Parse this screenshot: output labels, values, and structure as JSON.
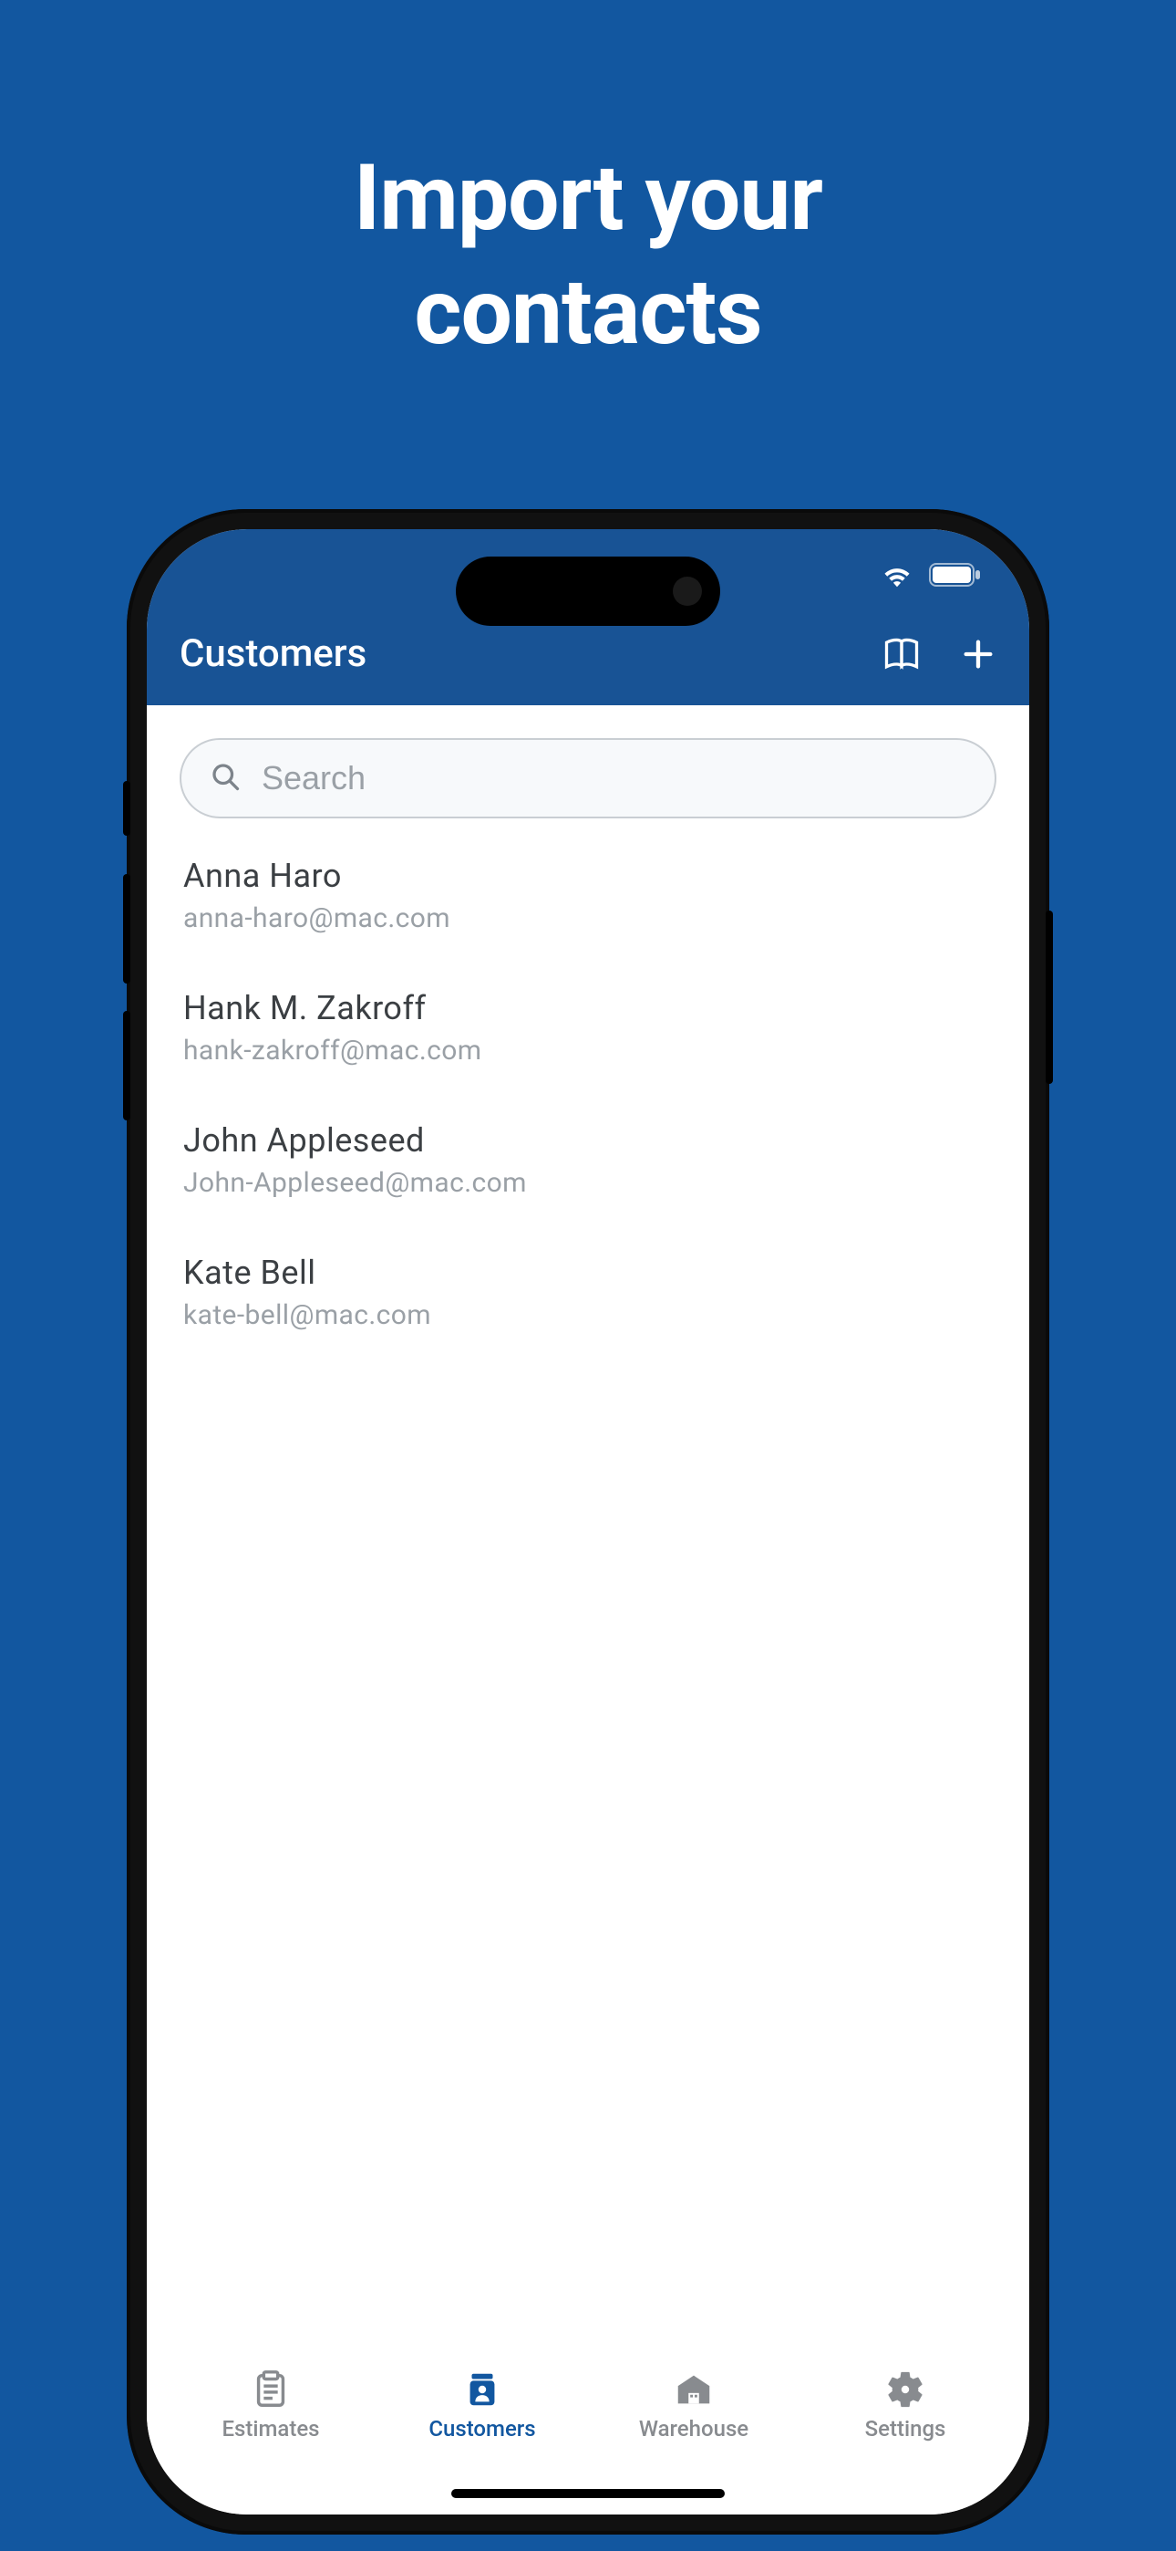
{
  "promo": {
    "title_line1": "Import your",
    "title_line2": "contacts"
  },
  "header": {
    "title": "Customers"
  },
  "search": {
    "placeholder": "Search",
    "value": ""
  },
  "customers": [
    {
      "name": "Anna Haro",
      "email": "anna-haro@mac.com"
    },
    {
      "name": "Hank M. Zakroff",
      "email": "hank-zakroff@mac.com"
    },
    {
      "name": "John Appleseed",
      "email": "John-Appleseed@mac.com"
    },
    {
      "name": "Kate Bell",
      "email": "kate-bell@mac.com"
    }
  ],
  "tabs": [
    {
      "label": "Estimates",
      "active": false
    },
    {
      "label": "Customers",
      "active": true
    },
    {
      "label": "Warehouse",
      "active": false
    },
    {
      "label": "Settings",
      "active": false
    }
  ]
}
